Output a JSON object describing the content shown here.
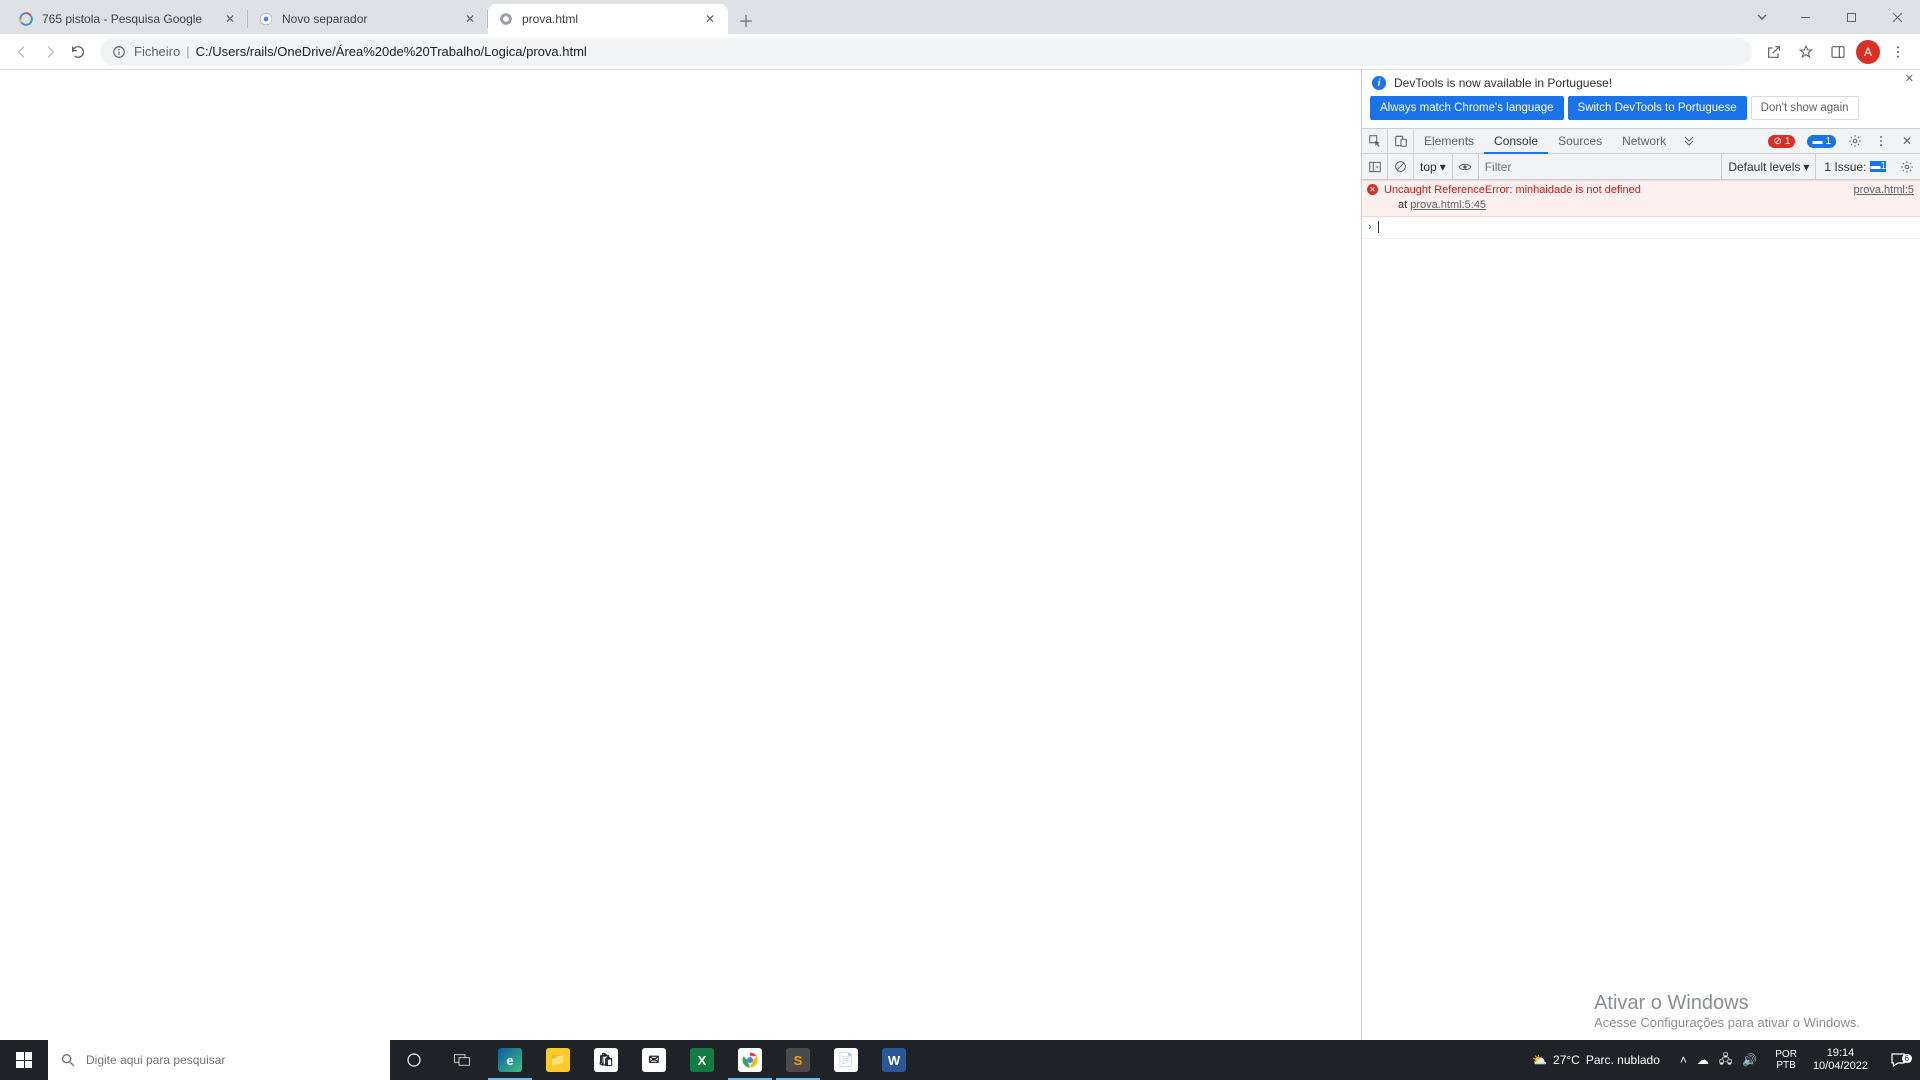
{
  "tabs": [
    {
      "title": "765 pistola - Pesquisa Google",
      "favicon": "google"
    },
    {
      "title": "Novo separador",
      "favicon": "chrome"
    },
    {
      "title": "prova.html",
      "favicon": "generic"
    }
  ],
  "addressbar": {
    "chip": "Ficheiro",
    "url": "C:/Users/rails/OneDrive/Área%20de%20Trabalho/Logica/prova.html",
    "avatar_letter": "A"
  },
  "devtools": {
    "info_text": "DevTools is now available in Portuguese!",
    "btn_always": "Always match Chrome's language",
    "btn_switch": "Switch DevTools to Portuguese",
    "btn_dont": "Don't show again",
    "tabs": {
      "elements": "Elements",
      "console": "Console",
      "sources": "Sources",
      "network": "Network"
    },
    "error_count": "1",
    "issue_count": "1",
    "context_label": "top",
    "filter_placeholder": "Filter",
    "levels_label": "Default levels",
    "issues_label": "1 Issue:",
    "issues_badge": "1",
    "console_error": {
      "message": "Uncaught ReferenceError: minhaidade is not defined",
      "stack_prefix": "at ",
      "stack_link": "prova.html:5:45",
      "source_link": "prova.html:5"
    }
  },
  "watermark": {
    "line1": "Ativar o Windows",
    "line2": "Acesse Configurações para ativar o Windows."
  },
  "taskbar": {
    "search_placeholder": "Digite aqui para pesquisar",
    "weather_temp": "27°C",
    "weather_desc": "Parc. nublado",
    "lang1": "POR",
    "lang2": "PTB",
    "time": "19:14",
    "date": "10/04/2022",
    "notif_count": "6"
  }
}
